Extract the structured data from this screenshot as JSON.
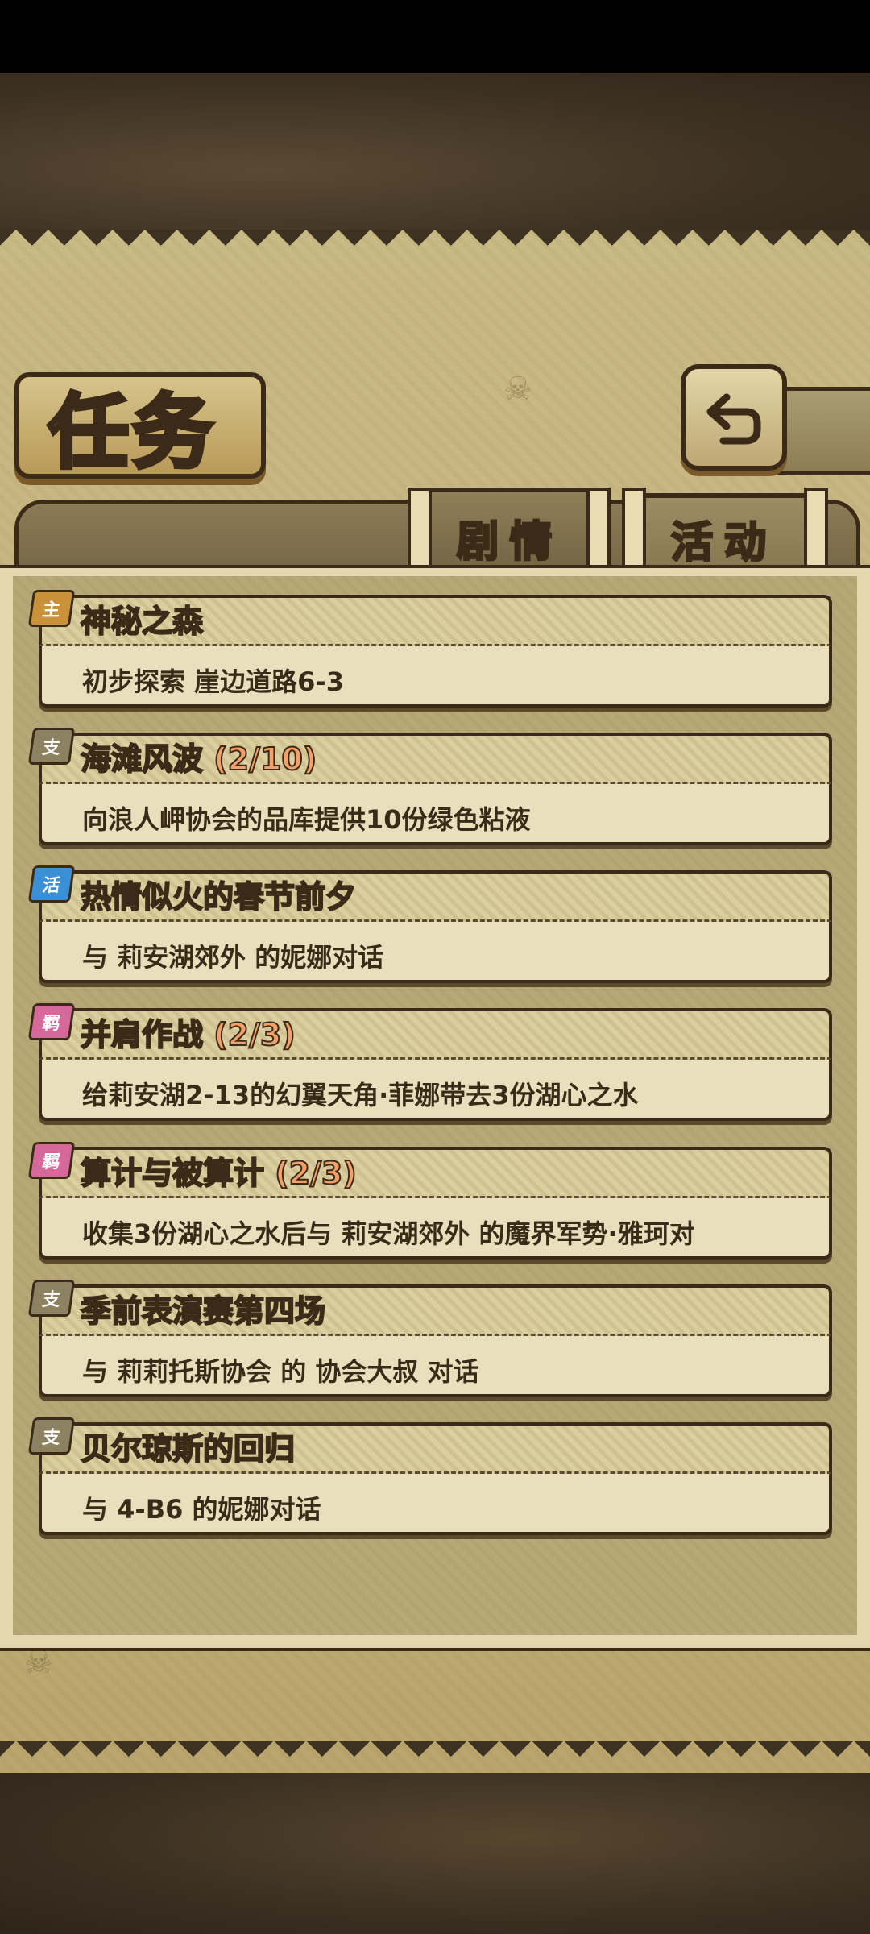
{
  "header": {
    "title": "任务"
  },
  "tabs": [
    {
      "label": "剧情",
      "active": true
    },
    {
      "label": "活动",
      "active": false
    }
  ],
  "quests": [
    {
      "badge": "主",
      "badge_color": "#c9923a",
      "title": "神秘之森",
      "progress": "",
      "description": "初步探索 崖边道路6-3"
    },
    {
      "badge": "支",
      "badge_color": "#8c8161",
      "title": "海滩风波",
      "progress": "(2/10)",
      "description": "向浪人岬协会的品库提供10份绿色粘液"
    },
    {
      "badge": "活",
      "badge_color": "#3b8fd4",
      "title": "热情似火的春节前夕",
      "progress": "",
      "description": "与 莉安湖郊外 的妮娜对话"
    },
    {
      "badge": "羁",
      "badge_color": "#d6689a",
      "title": "并肩作战",
      "progress": "(2/3)",
      "description": "给莉安湖2-13的幻翼天角·菲娜带去3份湖心之水"
    },
    {
      "badge": "羁",
      "badge_color": "#d6689a",
      "title": "算计与被算计",
      "progress": "(2/3)",
      "description": "收集3份湖心之水后与 莉安湖郊外 的魔界军势·雅珂对"
    },
    {
      "badge": "支",
      "badge_color": "#8c8161",
      "title": "季前表演赛第四场",
      "progress": "",
      "description": "与 莉莉托斯协会 的 协会大叔 对话"
    },
    {
      "badge": "支",
      "badge_color": "#8c8161",
      "title": "贝尔琼斯的回归",
      "progress": "",
      "description": "与 4-B6 的妮娜对话"
    }
  ]
}
